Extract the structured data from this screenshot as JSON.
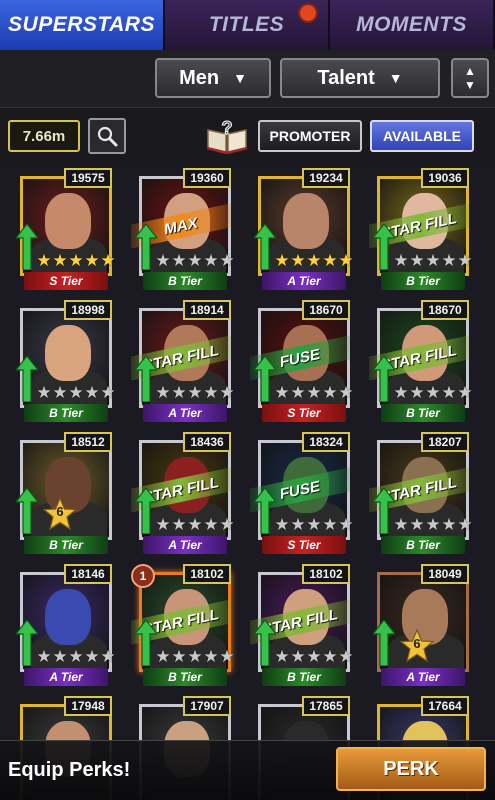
{
  "tabs": [
    {
      "label": "SUPERSTARS",
      "active": true
    },
    {
      "label": "TITLES",
      "active": false
    },
    {
      "label": "MOMENTS",
      "active": false
    }
  ],
  "filters": {
    "gender": "Men",
    "sort_by": "Talent",
    "sort_icon": "sort-up-down-icon"
  },
  "toolbar": {
    "currency": "7.66m",
    "search_icon": "magnifier-icon",
    "help_icon": "question-book-icon",
    "promoter_label": "PROMOTER",
    "available_label": "AVAILABLE"
  },
  "cards": [
    {
      "score": "19575",
      "tier": "S Tier",
      "stars": 5,
      "banner": "",
      "frame": "gold",
      "big_star": "",
      "badge": "",
      "skin": "#c48a6a",
      "bg": "#6b1d1d"
    },
    {
      "score": "19360",
      "tier": "B Tier",
      "stars": 0,
      "banner": "MAX",
      "frame": "silver",
      "big_star": "",
      "badge": "",
      "skin": "#d2a07e",
      "bg": "#6b1414"
    },
    {
      "score": "19234",
      "tier": "A Tier",
      "stars": 5,
      "banner": "",
      "frame": "gold",
      "big_star": "",
      "badge": "",
      "skin": "#b9856a",
      "bg": "#5a3a2a"
    },
    {
      "score": "19036",
      "tier": "B Tier",
      "stars": 0,
      "banner": "STAR FILL",
      "frame": "gold",
      "big_star": "",
      "badge": "",
      "skin": "#e0b8a0",
      "bg": "#7a6a1a"
    },
    {
      "score": "18998",
      "tier": "B Tier",
      "stars": 0,
      "banner": "",
      "frame": "silver",
      "big_star": "",
      "badge": "",
      "skin": "#d8a580",
      "bg": "#3a3a4a"
    },
    {
      "score": "18914",
      "tier": "A Tier",
      "stars": 0,
      "banner": "STAR FILL",
      "frame": "silver",
      "big_star": "",
      "badge": "",
      "skin": "#b07a5a",
      "bg": "#6a1a1a"
    },
    {
      "score": "18670",
      "tier": "S Tier",
      "stars": 0,
      "banner": "FUSE",
      "frame": "silver",
      "big_star": "",
      "badge": "",
      "skin": "#a86f52",
      "bg": "#5a1010"
    },
    {
      "score": "18670",
      "tier": "B Tier",
      "stars": 0,
      "banner": "STAR FILL",
      "frame": "silver",
      "big_star": "",
      "badge": "",
      "skin": "#d09a7a",
      "bg": "#1f4a1f"
    },
    {
      "score": "18512",
      "tier": "B Tier",
      "stars": 0,
      "banner": "",
      "frame": "silver",
      "big_star": "6",
      "badge": "",
      "skin": "#6a432e",
      "bg": "#6a5a2a"
    },
    {
      "score": "18436",
      "tier": "A Tier",
      "stars": 0,
      "banner": "STAR FILL",
      "frame": "silver",
      "big_star": "",
      "badge": "",
      "skin": "#8a2020",
      "bg": "#4a3a10"
    },
    {
      "score": "18324",
      "tier": "S Tier",
      "stars": 0,
      "banner": "FUSE",
      "frame": "silver",
      "big_star": "",
      "badge": "",
      "skin": "#3f6a3a",
      "bg": "#1a2a4a"
    },
    {
      "score": "18207",
      "tier": "B Tier",
      "stars": 0,
      "banner": "STAR FILL",
      "frame": "silver",
      "big_star": "",
      "badge": "",
      "skin": "#8a7050",
      "bg": "#4a3a1a"
    },
    {
      "score": "18146",
      "tier": "A Tier",
      "stars": 0,
      "banner": "",
      "frame": "silver",
      "big_star": "",
      "badge": "",
      "skin": "#3a4ab0",
      "bg": "#3a2a6a"
    },
    {
      "score": "18102",
      "tier": "B Tier",
      "stars": 0,
      "banner": "STAR FILL",
      "frame": "orange",
      "big_star": "",
      "badge": "1",
      "skin": "#c9957a",
      "bg": "#2a4a2a"
    },
    {
      "score": "18102",
      "tier": "B Tier",
      "stars": 0,
      "banner": "STAR FILL",
      "frame": "silver",
      "big_star": "",
      "badge": "",
      "skin": "#d0a07e",
      "bg": "#4a1a5a"
    },
    {
      "score": "18049",
      "tier": "A Tier",
      "stars": 0,
      "banner": "",
      "frame": "copper",
      "big_star": "6",
      "badge": "",
      "skin": "#a87a5a",
      "bg": "#3a2a20"
    },
    {
      "score": "17948",
      "tier": "",
      "stars": 0,
      "banner": "",
      "frame": "gold",
      "big_star": "",
      "badge": "",
      "skin": "#c09070",
      "bg": "#3a3a3a"
    },
    {
      "score": "17907",
      "tier": "",
      "stars": 0,
      "banner": "",
      "frame": "silver",
      "big_star": "",
      "badge": "",
      "skin": "#c9a080",
      "bg": "#3a3a3a"
    },
    {
      "score": "17865",
      "tier": "",
      "stars": 0,
      "banner": "",
      "frame": "silver",
      "big_star": "",
      "badge": "",
      "skin": "#2a2a2a",
      "bg": "#2a2a2a"
    },
    {
      "score": "17664",
      "tier": "",
      "stars": 0,
      "banner": "",
      "frame": "gold",
      "big_star": "",
      "badge": "",
      "skin": "#e2c25a",
      "bg": "#3a3a6a"
    }
  ],
  "bottom": {
    "equip_text": "Equip Perks!",
    "perk_label": "PERK"
  },
  "colors": {
    "active_tab": "#2f56d6",
    "tier_S": "#c42222",
    "tier_A": "#7a30c4",
    "tier_B": "#2d8a2a",
    "perk_button": "#e89a3a"
  }
}
